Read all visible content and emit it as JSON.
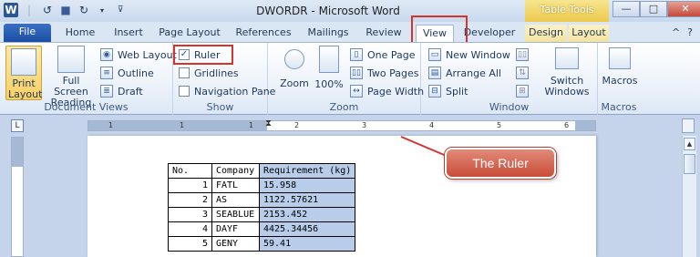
{
  "titlebar": {
    "title": "DWORDR - Microsoft Word",
    "context_tab_group": "Table Tools",
    "word_logo": "W",
    "window_buttons": [
      "minimize",
      "maximize",
      "close"
    ]
  },
  "tabs": {
    "file": "File",
    "home": "Home",
    "insert": "Insert",
    "page_layout": "Page Layout",
    "references": "References",
    "mailings": "Mailings",
    "review": "Review",
    "view": "View",
    "developer": "Developer",
    "design": "Design",
    "layout": "Layout"
  },
  "ribbon": {
    "document_views": {
      "label": "Document Views",
      "print_layout": "Print Layout",
      "full_screen_reading": "Full Screen Reading",
      "web_layout": "Web Layout",
      "outline": "Outline",
      "draft": "Draft"
    },
    "show": {
      "label": "Show",
      "ruler": "Ruler",
      "ruler_checked": true,
      "gridlines": "Gridlines",
      "navigation_pane": "Navigation Pane"
    },
    "zoom": {
      "label": "Zoom",
      "zoom": "Zoom",
      "percent": "100%",
      "one_page": "One Page",
      "two_pages": "Two Pages",
      "page_width": "Page Width"
    },
    "window": {
      "label": "Window",
      "new_window": "New Window",
      "arrange_all": "Arrange All",
      "split": "Split",
      "switch_windows": "Switch Windows"
    },
    "macros": {
      "label": "Macros",
      "macros": "Macros"
    }
  },
  "ruler": {
    "ticks": [
      "1",
      "1",
      "1",
      "2",
      "3",
      "4",
      "5",
      "6"
    ]
  },
  "callout": {
    "text": "The Ruler"
  },
  "document": {
    "table": {
      "headers": [
        "No.",
        "Company",
        "Requirement (kg)"
      ],
      "rows": [
        [
          "1",
          "FATL",
          "15.958"
        ],
        [
          "2",
          "AS",
          "1122.57621"
        ],
        [
          "3",
          "SEABLUE",
          "2153.452"
        ],
        [
          "4",
          "DAYF",
          "4425.34456"
        ],
        [
          "5",
          "GENY",
          "59.41"
        ]
      ]
    }
  },
  "colors": {
    "highlight": "#d5342c",
    "file_tab": "#2b5797",
    "callout": "#c94d38",
    "selection": "#b7cdea"
  }
}
